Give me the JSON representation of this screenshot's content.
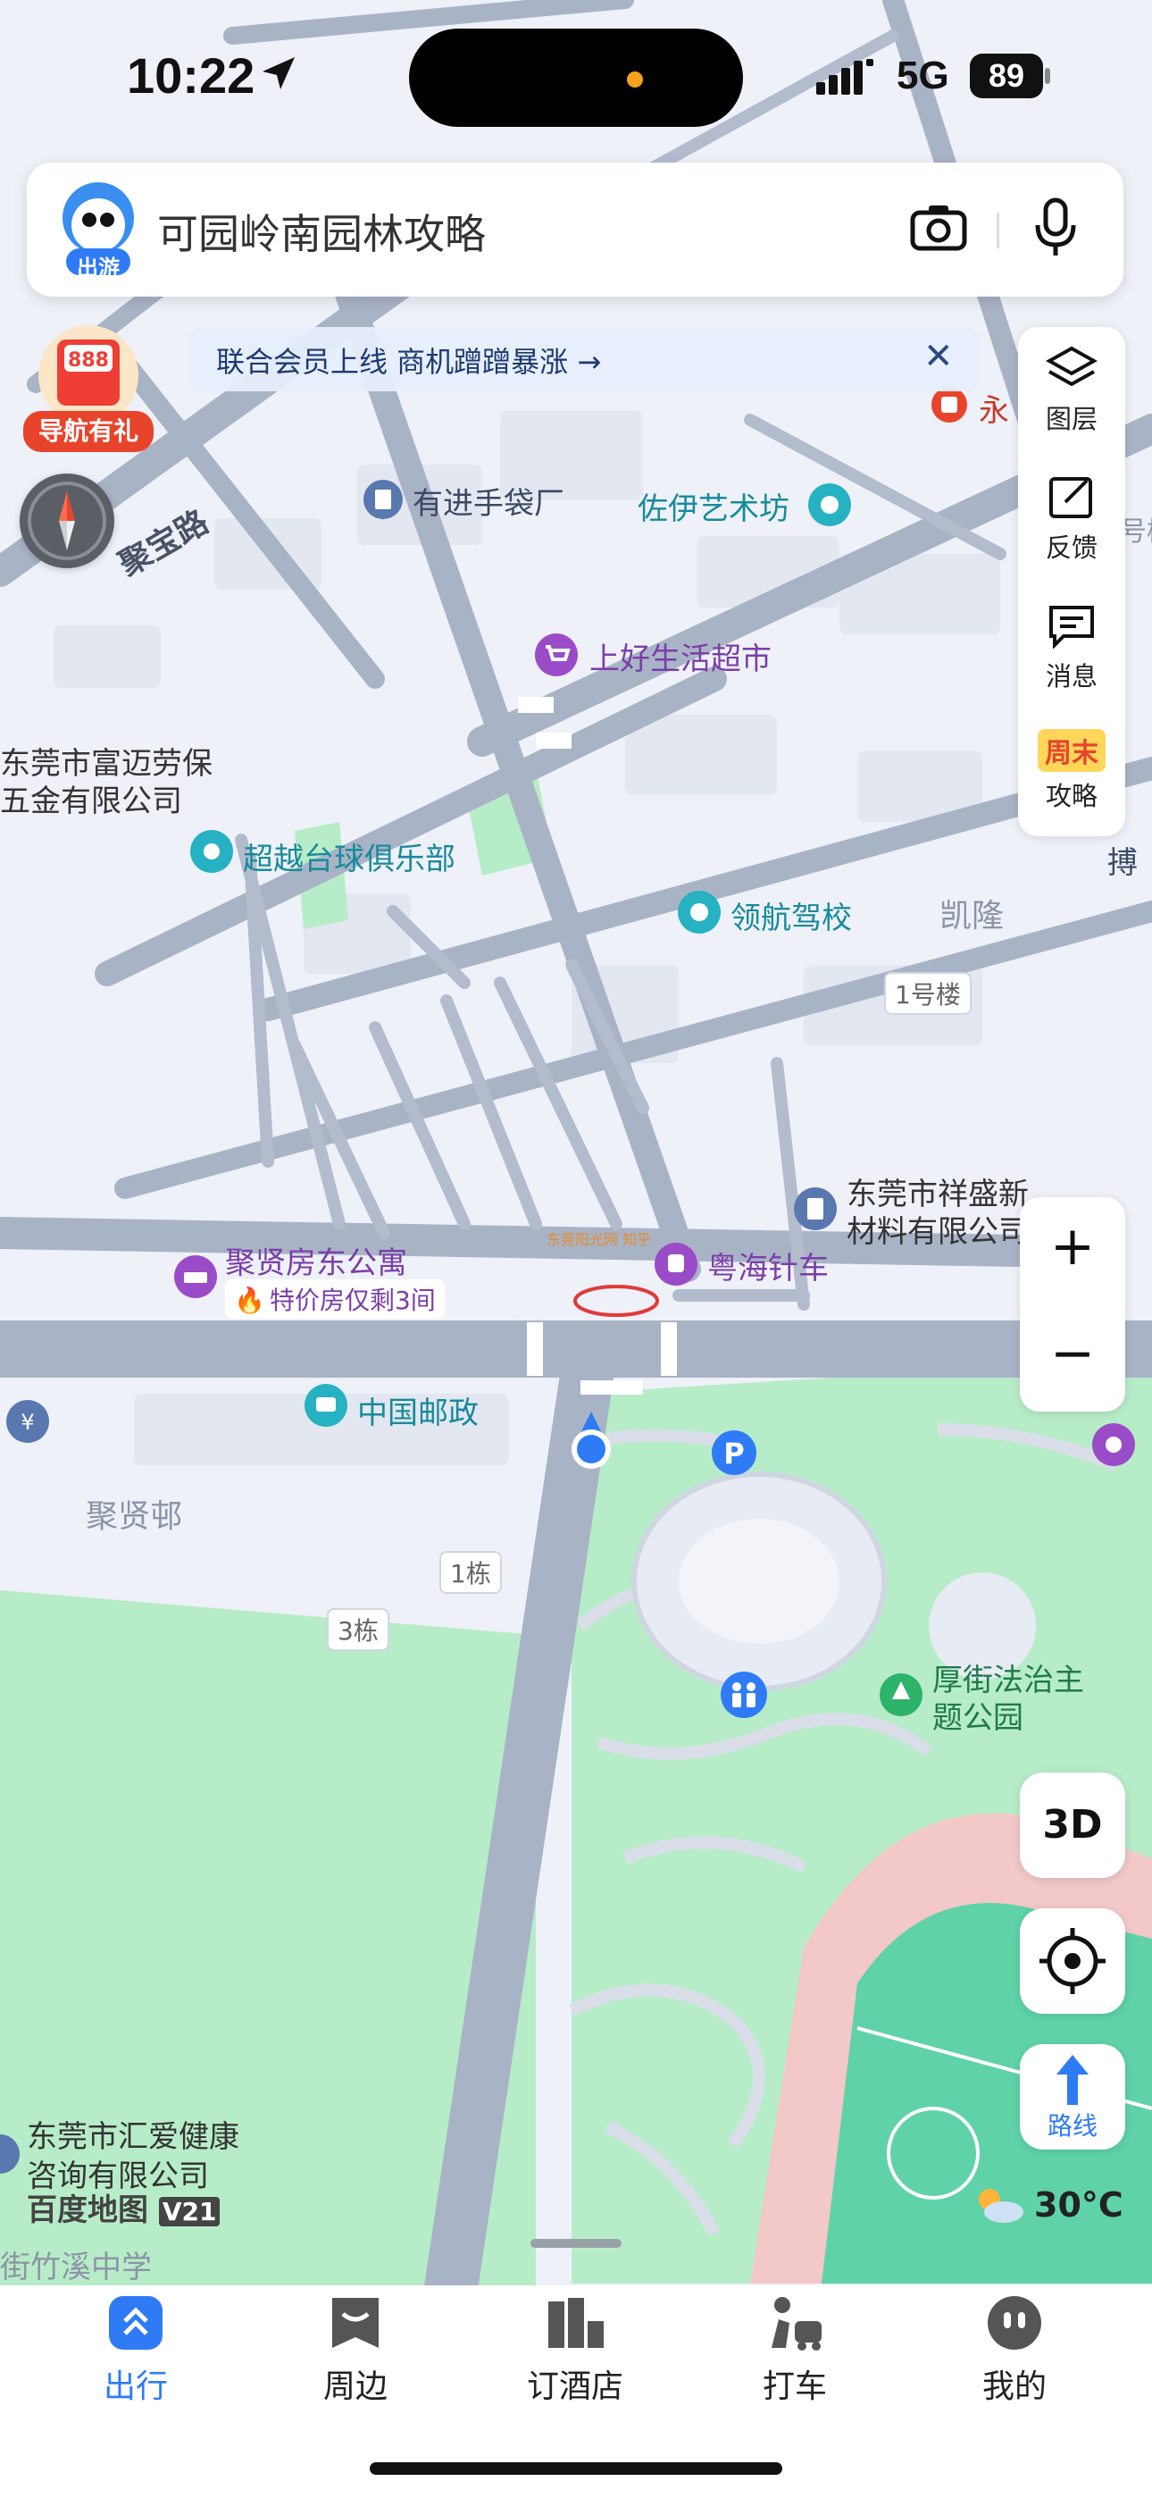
{
  "status_bar": {
    "time": "10:22",
    "network": "5G",
    "battery": "89"
  },
  "search": {
    "mascot_label": "出游",
    "placeholder": "可园岭南园林攻略"
  },
  "banner": {
    "text": "联合会员上线 商机蹭蹭暴涨 →"
  },
  "gift": {
    "badge": "888",
    "label": "导航有礼"
  },
  "side_panel": [
    {
      "icon": "layers-icon",
      "label": "图层"
    },
    {
      "icon": "feedback-icon",
      "label": "反馈"
    },
    {
      "icon": "message-icon",
      "label": "消息"
    },
    {
      "icon": "weekend-icon",
      "badge": "周末",
      "label": "攻略"
    }
  ],
  "map": {
    "road_labels": [
      "聚宝路"
    ],
    "pois": [
      {
        "name": "永",
        "type": "red"
      },
      {
        "name": "有进手袋厂",
        "type": "office"
      },
      {
        "name": "佐伊艺术坊",
        "type": "art"
      },
      {
        "name": "上好生活超市",
        "type": "shop"
      },
      {
        "name": "东莞市富迈劳保五金有限公司",
        "type": "company"
      },
      {
        "name": "超越台球俱乐部",
        "type": "sport"
      },
      {
        "name": "领航驾校",
        "type": "school"
      },
      {
        "name": "凯隆",
        "type": "area"
      },
      {
        "name": "1号楼",
        "type": "tag"
      },
      {
        "name": "东莞市祥盛新材料有限公司",
        "type": "company"
      },
      {
        "name": "聚贤房东公寓",
        "type": "hotel"
      },
      {
        "name": "特价房仅剩3间",
        "type": "promo"
      },
      {
        "name": "粤海针车",
        "type": "shop"
      },
      {
        "name": "中国邮政",
        "type": "post"
      },
      {
        "name": "聚贤邨",
        "type": "area"
      },
      {
        "name": "1栋",
        "type": "tag"
      },
      {
        "name": "3栋",
        "type": "tag"
      },
      {
        "name": "厚街法治主题公园",
        "type": "park"
      },
      {
        "name": "东莞市汇爱健康咨询有限公司",
        "type": "company"
      },
      {
        "name": "街竹溪中学",
        "type": "school"
      },
      {
        "name": "搏",
        "type": "edge"
      },
      {
        "name": "号楼",
        "type": "edge"
      }
    ],
    "watermark": "东莞阳光网 知乎"
  },
  "controls": {
    "zoom_in": "+",
    "zoom_out": "−",
    "three_d": "3D",
    "route": "路线"
  },
  "weather": {
    "temperature": "30°C"
  },
  "brand": {
    "logo": "百度地图",
    "version": "V21"
  },
  "tabs": [
    {
      "label": "出行",
      "active": true
    },
    {
      "label": "周边",
      "active": false
    },
    {
      "label": "订酒店",
      "active": false
    },
    {
      "label": "打车",
      "active": false
    },
    {
      "label": "我的",
      "active": false
    }
  ],
  "colors": {
    "accent": "#2f7bf5",
    "road": "#a9b3c6",
    "park": "#b6ecc6",
    "track": "#f2c2c2",
    "field": "#5fd3a7"
  }
}
